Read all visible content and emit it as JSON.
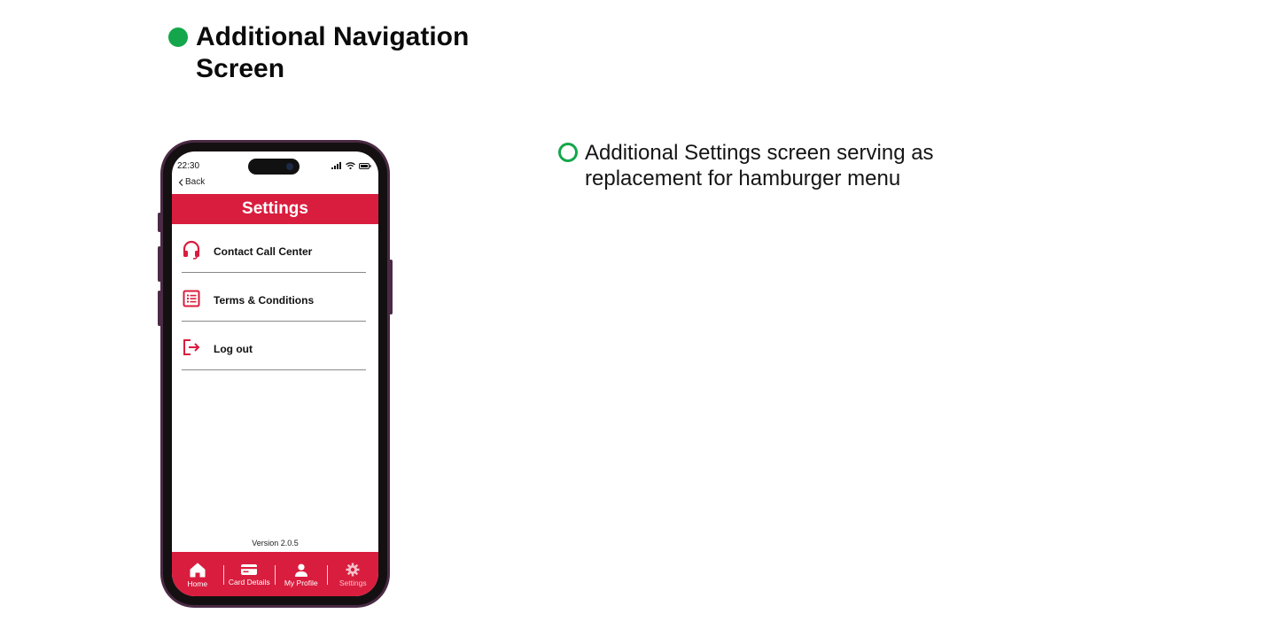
{
  "heading": {
    "title": "Additional Navigation Screen"
  },
  "note": {
    "text": "Additional Settings screen serving as replacement for hamburger menu"
  },
  "phone": {
    "status": {
      "time": "22:30"
    },
    "back_label": "Back",
    "app_title": "Settings",
    "menu": [
      {
        "label": "Contact Call Center",
        "icon": "headset-icon"
      },
      {
        "label": "Terms & Conditions",
        "icon": "list-icon"
      },
      {
        "label": "Log out",
        "icon": "logout-icon"
      }
    ],
    "version": "Version 2.0.5",
    "tabs": [
      {
        "label": "Home",
        "icon": "home-icon"
      },
      {
        "label": "Card Details",
        "icon": "card-icon"
      },
      {
        "label": "My Profile",
        "icon": "user-icon"
      },
      {
        "label": "Settings",
        "icon": "gear-icon"
      }
    ]
  },
  "colors": {
    "accent": "#d91d3e",
    "bullet": "#14a64a",
    "phone_frame": "#4a2a44"
  }
}
